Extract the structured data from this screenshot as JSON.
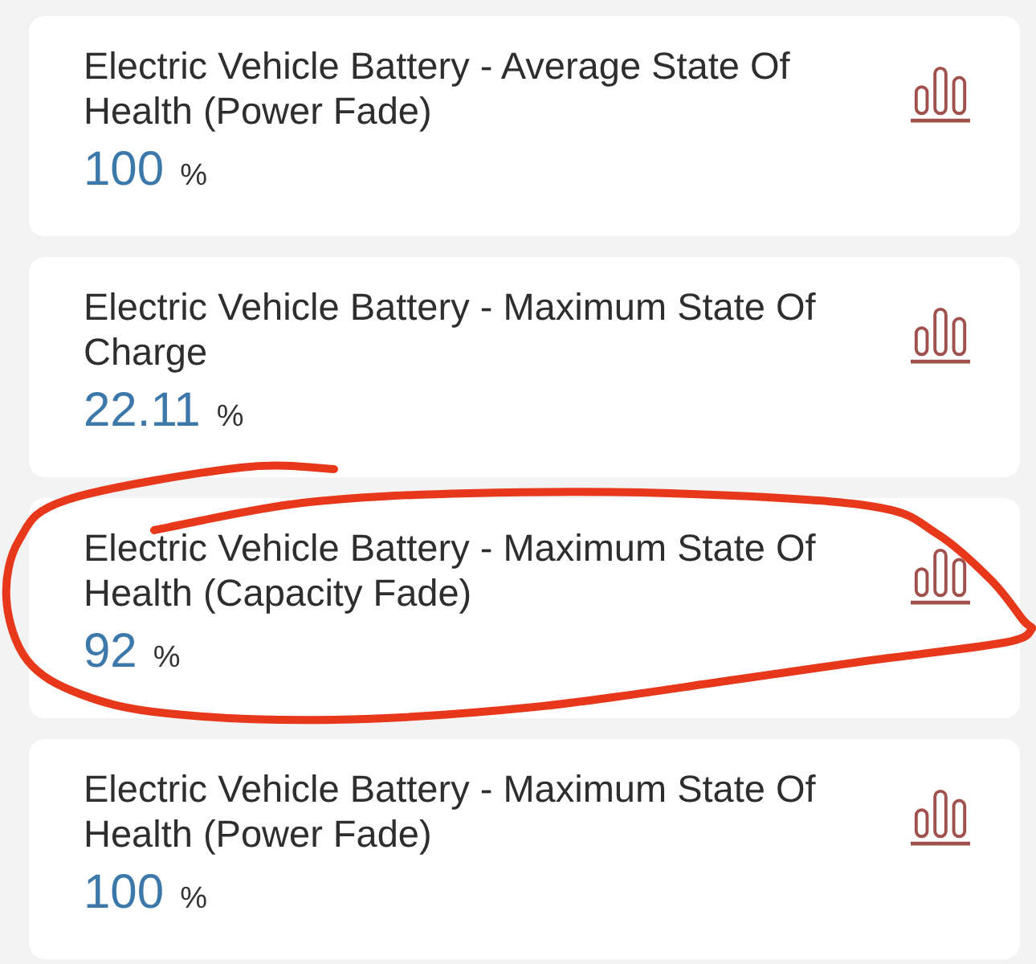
{
  "metrics": [
    {
      "title": "Electric Vehicle Battery - Average State Of Health (Power Fade)",
      "value": "100",
      "unit": "%",
      "circled": false
    },
    {
      "title": "Electric Vehicle Battery - Maximum State Of Charge",
      "value": "22.11",
      "unit": "%",
      "circled": false
    },
    {
      "title": "Electric Vehicle Battery - Maximum State Of Health (Capacity Fade)",
      "value": "92",
      "unit": "%",
      "circled": true
    },
    {
      "title": "Electric Vehicle Battery - Maximum State Of Health (Power Fade)",
      "value": "100",
      "unit": "%",
      "circled": false
    }
  ]
}
